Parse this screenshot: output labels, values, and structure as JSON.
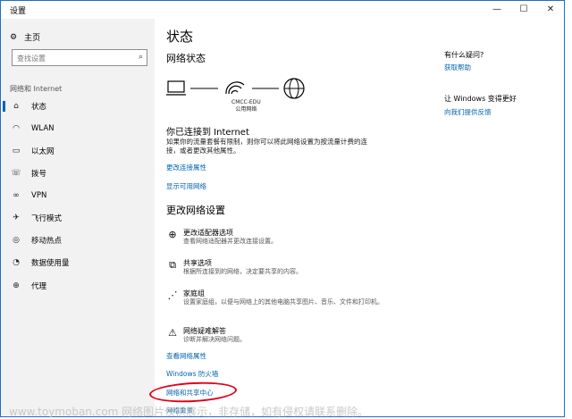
{
  "window": {
    "title": "设置",
    "minimize": "—",
    "maximize": "☐",
    "close": "✕"
  },
  "sidebar": {
    "home_label": "主页",
    "search_placeholder": "查找设置",
    "section": "网络和 Internet",
    "items": [
      {
        "label": "状态",
        "icon": "status-icon"
      },
      {
        "label": "WLAN",
        "icon": "wifi-icon"
      },
      {
        "label": "以太网",
        "icon": "ethernet-icon"
      },
      {
        "label": "拨号",
        "icon": "dialup-icon"
      },
      {
        "label": "VPN",
        "icon": "vpn-icon"
      },
      {
        "label": "飞行模式",
        "icon": "airplane-icon"
      },
      {
        "label": "移动热点",
        "icon": "hotspot-icon"
      },
      {
        "label": "数据使用量",
        "icon": "data-usage-icon"
      },
      {
        "label": "代理",
        "icon": "proxy-icon"
      }
    ]
  },
  "main": {
    "title": "状态",
    "network_status": "网络状态",
    "ssid": "CMCC-EDU",
    "network_type": "公用网络",
    "connected": "你已连接到 Internet",
    "description": "如果你的流量套餐有限制，则你可以将此网络设置为按流量计费的连接，或者更改其他属性。",
    "link_change_props": "更改连接属性",
    "link_show_networks": "显示可用网络",
    "change_settings": "更改网络设置",
    "options": [
      {
        "title": "更改适配器选项",
        "desc": "查看网络适配器并更改连接设置。"
      },
      {
        "title": "共享选项",
        "desc": "根据所连接到的网络，决定要共享的内容。"
      },
      {
        "title": "家庭组",
        "desc": "设置家庭组，以便与网络上的其他电脑共享图片、音乐、文件和打印机。"
      },
      {
        "title": "网络疑难解答",
        "desc": "诊断并解决网络问题。"
      }
    ],
    "link_view_props": "查看网络属性",
    "link_firewall": "Windows 防火墙",
    "link_sharing_center": "网络和共享中心",
    "link_reset": "网络重置"
  },
  "right": {
    "help_q": "有什么疑问?",
    "help_link": "获取帮助",
    "improve": "让 Windows 变得更好",
    "feedback_link": "向我们提供反馈"
  },
  "watermark": "www.toymoban.com 网络图片仅供展示，非存储，如有侵权请联系删除。"
}
